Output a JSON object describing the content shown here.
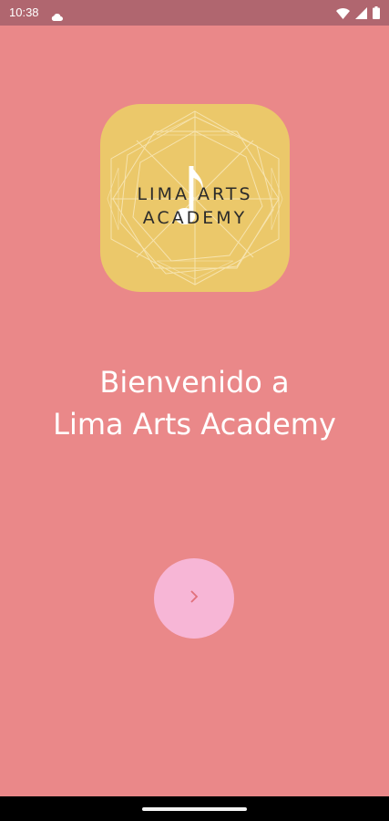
{
  "status_bar": {
    "time": "10:38",
    "icons": [
      "cloud-icon",
      "wifi-icon",
      "signal-icon",
      "battery-icon"
    ]
  },
  "logo": {
    "line1": "LIMA ARTS",
    "line2": "ACADEMY",
    "icon": "music-note-icon"
  },
  "welcome": {
    "line1": "Bienvenido a",
    "line2": "Lima Arts Academy"
  },
  "next_button": {
    "icon": "chevron-right-icon"
  },
  "colors": {
    "background": "#ea8889",
    "status_bar": "#b0666f",
    "logo_tile": "#ebc86a",
    "button": "#f7b6d6",
    "button_icon": "#e06f7a"
  }
}
